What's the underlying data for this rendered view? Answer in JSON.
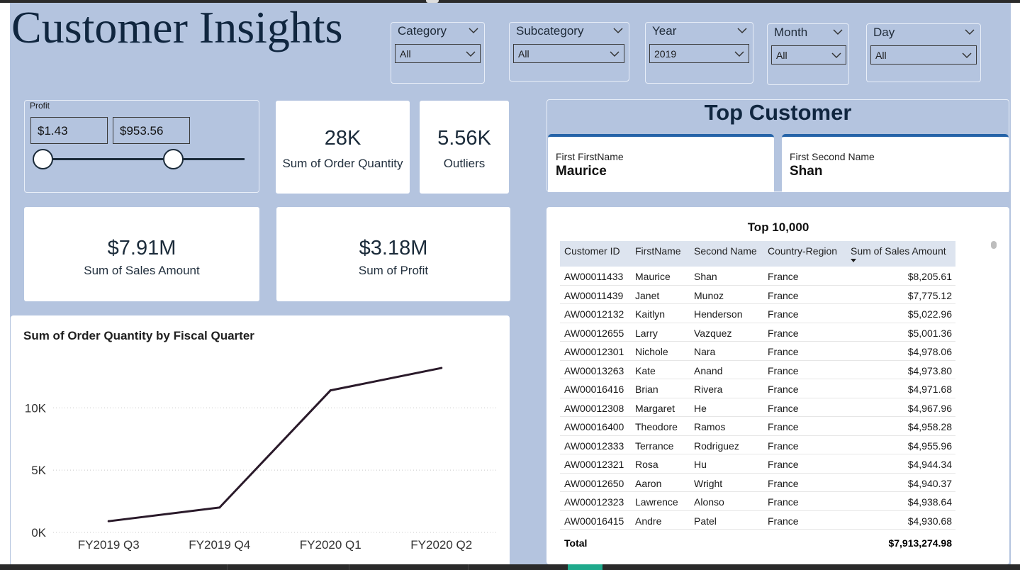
{
  "title": "Customer Insights",
  "filters": [
    {
      "label": "Category",
      "value": "All"
    },
    {
      "label": "Subcategory",
      "value": "All"
    },
    {
      "label": "Year",
      "value": "2019"
    },
    {
      "label": "Month",
      "value": "All"
    },
    {
      "label": "Day",
      "value": "All"
    }
  ],
  "profit_slicer": {
    "label": "Profit",
    "min": "$1.43",
    "max": "$953.56"
  },
  "kpis": {
    "order_qty": {
      "value": "28K",
      "label": "Sum of Order Quantity"
    },
    "outliers": {
      "value": "5.56K",
      "label": "Outliers"
    },
    "sales": {
      "value": "$7.91M",
      "label": "Sum of Sales Amount"
    },
    "profit": {
      "value": "$3.18M",
      "label": "Sum of Profit"
    }
  },
  "top_customer": {
    "heading": "Top Customer",
    "first_label": "First FirstName",
    "first_value": "Maurice",
    "second_label": "First Second Name",
    "second_value": "Shan"
  },
  "chart_data": {
    "type": "line",
    "title": "Sum of Order Quantity by Fiscal Quarter",
    "categories": [
      "FY2019 Q3",
      "FY2019 Q4",
      "FY2020 Q1",
      "FY2020 Q2"
    ],
    "values": [
      900,
      2000,
      11400,
      13200
    ],
    "ylim": [
      0,
      14000
    ],
    "yticks": [
      0,
      5000,
      10000
    ],
    "ytick_labels": [
      "0K",
      "5K",
      "10K"
    ],
    "grid": true,
    "line_color": "#2a1a2a"
  },
  "table": {
    "title": "Top 10,000",
    "columns": [
      "Customer ID",
      "FirstName",
      "Second Name",
      "Country-Region",
      "Sum of Sales Amount"
    ],
    "rows": [
      [
        "AW00011433",
        "Maurice",
        "Shan",
        "France",
        "$8,205.61"
      ],
      [
        "AW00011439",
        "Janet",
        "Munoz",
        "France",
        "$7,775.12"
      ],
      [
        "AW00012132",
        "Kaitlyn",
        "Henderson",
        "France",
        "$5,022.96"
      ],
      [
        "AW00012655",
        "Larry",
        "Vazquez",
        "France",
        "$5,001.36"
      ],
      [
        "AW00012301",
        "Nichole",
        "Nara",
        "France",
        "$4,978.06"
      ],
      [
        "AW00013263",
        "Kate",
        "Anand",
        "France",
        "$4,973.80"
      ],
      [
        "AW00016416",
        "Brian",
        "Rivera",
        "France",
        "$4,971.68"
      ],
      [
        "AW00012308",
        "Margaret",
        "He",
        "France",
        "$4,967.96"
      ],
      [
        "AW00016400",
        "Theodore",
        "Ramos",
        "France",
        "$4,958.28"
      ],
      [
        "AW00012333",
        "Terrance",
        "Rodriguez",
        "France",
        "$4,955.96"
      ],
      [
        "AW00012321",
        "Rosa",
        "Hu",
        "France",
        "$4,944.34"
      ],
      [
        "AW00012650",
        "Aaron",
        "Wright",
        "France",
        "$4,940.37"
      ],
      [
        "AW00012323",
        "Lawrence",
        "Alonso",
        "France",
        "$4,938.64"
      ],
      [
        "AW00016415",
        "Andre",
        "Patel",
        "France",
        "$4,930.68"
      ]
    ],
    "total_label": "Total",
    "total_value": "$7,913,274.98"
  },
  "colors": {
    "background": "#b4c4df",
    "accent": "#2563a8",
    "text": "#10263f"
  }
}
